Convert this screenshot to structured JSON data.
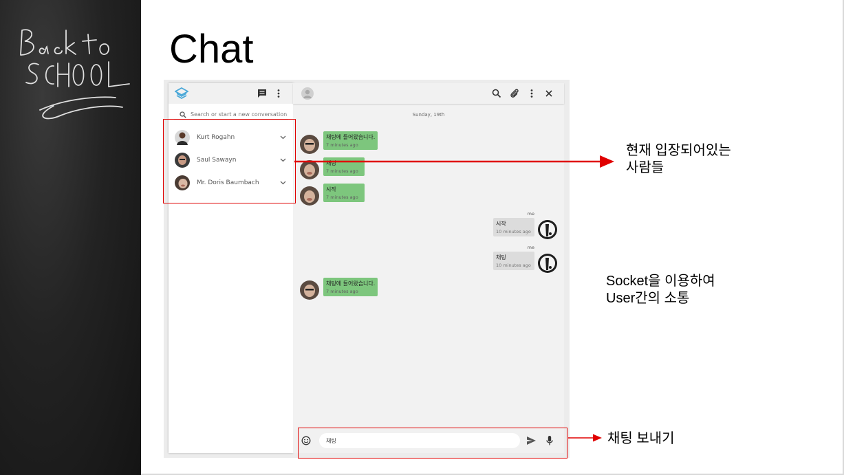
{
  "slide": {
    "title": "Chat",
    "chalk_text": [
      "Back to",
      "SCHOOL"
    ]
  },
  "sidebar": {
    "search_placeholder": "Search or start a new conversation",
    "contacts": [
      {
        "name": "Kurt Rogahn"
      },
      {
        "name": "Saul Sawayn"
      },
      {
        "name": "Mr. Doris Baumbach"
      }
    ]
  },
  "chat": {
    "date_label": "Sunday, 19th",
    "messages": [
      {
        "direction": "in",
        "text": "채팅에 들어왔습니다.",
        "time": "7 minutes ago"
      },
      {
        "direction": "in",
        "text": "채팅",
        "time": "7 minutes ago"
      },
      {
        "direction": "in",
        "text": "시작",
        "time": "7 minutes ago"
      },
      {
        "direction": "out",
        "sender": "me",
        "text": "시작",
        "time": "10 minutes ago"
      },
      {
        "direction": "out",
        "sender": "me",
        "text": "채팅",
        "time": "10 minutes ago"
      },
      {
        "direction": "in",
        "text": "채팅에 들어왔습니다.",
        "time": "7 minutes ago"
      }
    ],
    "composer_value": "채팅"
  },
  "annotations": {
    "present_users": [
      "현재 입장되어있는",
      "사람들"
    ],
    "socket": [
      "Socket을 이용하여",
      "User간의 소통"
    ],
    "send_chat": "채팅 보내기"
  },
  "colors": {
    "accent_green": "#7dc67d",
    "annotation_red": "#e00000",
    "logo_blue": "#4aa8d8"
  },
  "icons": {
    "sidebar_header": [
      "new-chat-icon",
      "more-vertical-icon"
    ],
    "chat_header": [
      "avatar-placeholder-icon",
      "search-icon",
      "paperclip-icon",
      "more-vertical-icon",
      "close-icon"
    ],
    "composer": [
      "emoji-icon",
      "send-icon",
      "microphone-icon"
    ]
  }
}
